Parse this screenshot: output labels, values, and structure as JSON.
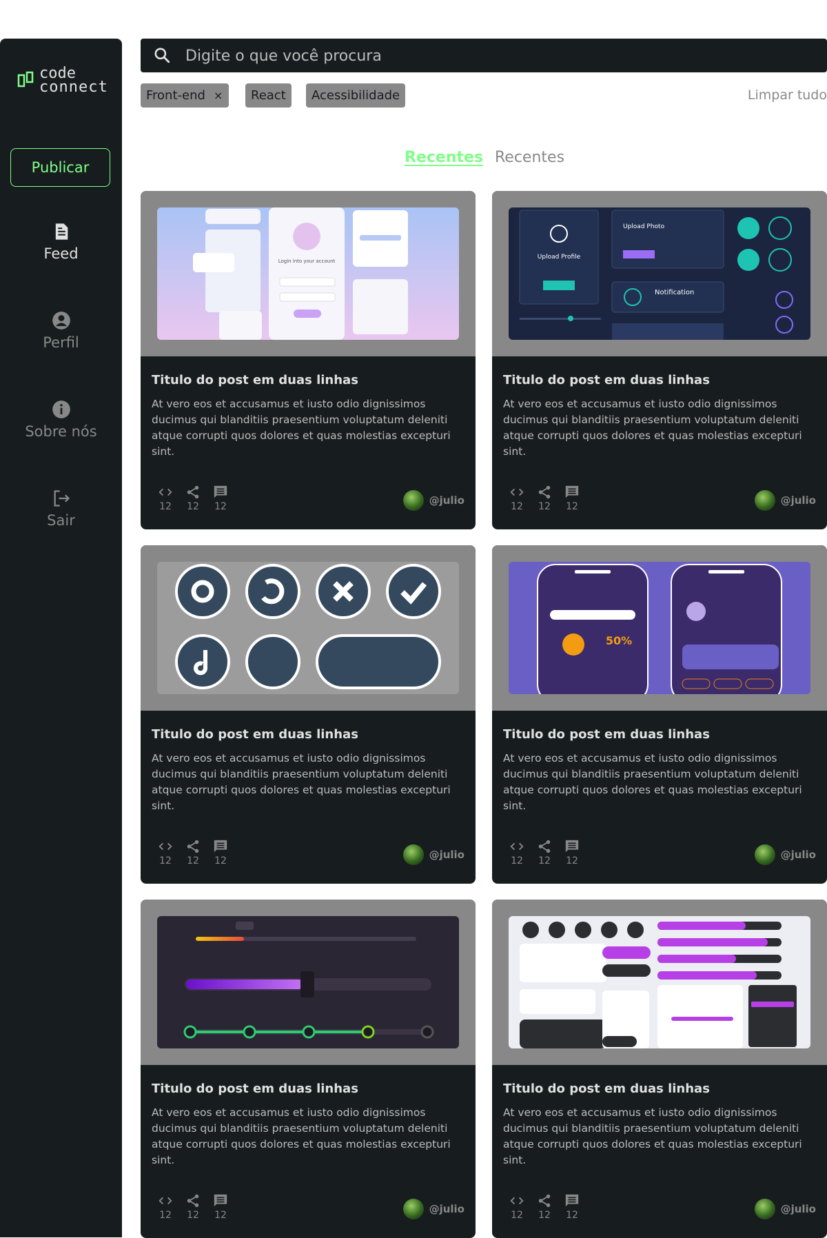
{
  "brand": {
    "line1": "code",
    "line2": "connect"
  },
  "sidebar": {
    "publish_label": "Publicar",
    "items": [
      {
        "label": "Feed",
        "icon": "document-icon"
      },
      {
        "label": "Perfil",
        "icon": "user-icon"
      },
      {
        "label": "Sobre nós",
        "icon": "info-icon"
      },
      {
        "label": "Sair",
        "icon": "logout-icon"
      }
    ]
  },
  "search": {
    "placeholder": "Digite o que você procura"
  },
  "filters": {
    "tags": [
      "Front-end",
      "React",
      "Acessibilidade"
    ],
    "remove_symbol": "×",
    "clear_label": "Limpar tudo"
  },
  "tabs": [
    "Recentes",
    "Recentes"
  ],
  "post": {
    "title": "Titulo do post em duas linhas",
    "body": "At vero eos et accusamus et iusto odio dignissimos ducimus qui blanditiis praesentium voluptatum deleniti atque corrupti quos dolores et quas molestias excepturi sint.",
    "code_count": "12",
    "share_count": "12",
    "comment_count": "12",
    "author": "@julio"
  },
  "colors": {
    "accent": "#81fe88",
    "sidebar_bg": "#171d1f",
    "muted": "#888888",
    "text_light": "#e1e1e1"
  }
}
